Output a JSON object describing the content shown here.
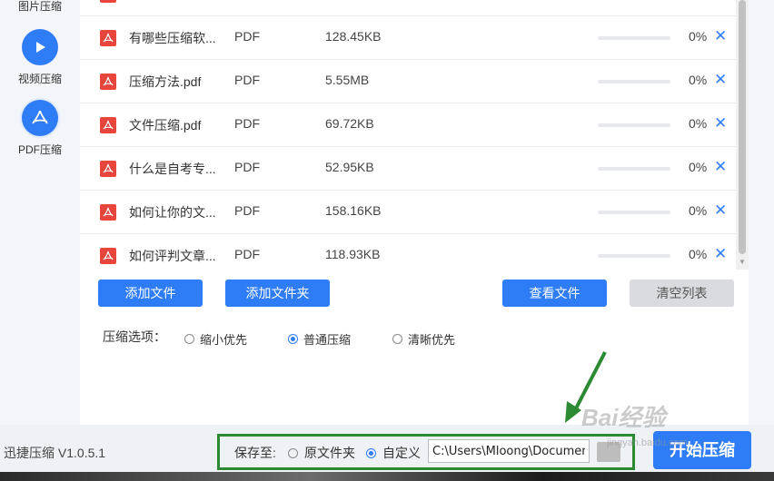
{
  "sidebar": {
    "items": [
      {
        "label": "图片压缩",
        "icon": "image-compress-icon"
      },
      {
        "label": "视频压缩",
        "icon": "play-icon"
      },
      {
        "label": "PDF压缩",
        "icon": "pdf-icon"
      }
    ]
  },
  "files": [
    {
      "name": "有哪些压缩软...",
      "type": "PDF",
      "size": "128.45KB",
      "progress": "0%"
    },
    {
      "name": "压缩方法.pdf",
      "type": "PDF",
      "size": "5.55MB",
      "progress": "0%"
    },
    {
      "name": "文件压缩.pdf",
      "type": "PDF",
      "size": "69.72KB",
      "progress": "0%"
    },
    {
      "name": "什么是自考专...",
      "type": "PDF",
      "size": "52.95KB",
      "progress": "0%"
    },
    {
      "name": "如何让你的文...",
      "type": "PDF",
      "size": "158.16KB",
      "progress": "0%"
    },
    {
      "name": "如何评判文章...",
      "type": "PDF",
      "size": "118.93KB",
      "progress": "0%"
    }
  ],
  "buttons": {
    "add_file": "添加文件",
    "add_folder": "添加文件夹",
    "view_file": "查看文件",
    "clear_list": "清空列表",
    "start": "开始压缩"
  },
  "options": {
    "label": "压缩选项：",
    "choices": [
      "缩小优先",
      "普通压缩",
      "清晰优先"
    ],
    "selected": "普通压缩"
  },
  "save": {
    "label": "保存至:",
    "choices": [
      "原文件夹",
      "自定义"
    ],
    "selected": "自定义",
    "path": "C:\\Users\\Mloong\\Documents"
  },
  "version": "迅捷压缩 V1.0.5.1",
  "watermark": "Bai经验",
  "watermark_sub": "jingyan.baidu.com",
  "colors": {
    "accent": "#2e7cf6",
    "pdf_red": "#e8453c",
    "annotation_green": "#2c8a33"
  }
}
